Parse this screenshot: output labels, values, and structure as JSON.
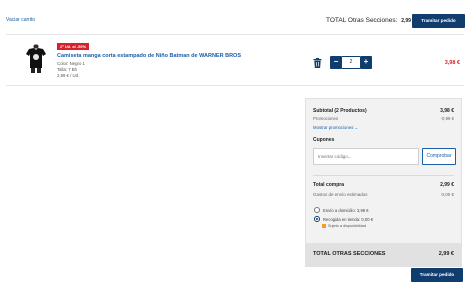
{
  "header": {
    "empty_cart": "Vaciar carrito",
    "total_label": "TOTAL Otras Secciones:",
    "total_value": "2,99 €",
    "checkout_label": "Tramitar pedido"
  },
  "cart": {
    "items": [
      {
        "badge": "2ª Ud. al -50%",
        "title": "Camiseta manga corta estampado de Niño Batman de WARNER BROS",
        "color": "Color: Negro 1",
        "size": "Talla: 7 Bh",
        "unit_price": "2,99 € / Ud.",
        "quantity": "2",
        "price": "3,98 €",
        "image_icon": "tshirt-icon"
      }
    ]
  },
  "summary": {
    "subtotal_label": "Subtotal (2 Productos)",
    "subtotal_value": "3,98 €",
    "promotions_label": "Promociones",
    "promotions_value": "-0,99 €",
    "show_promotions": "Mostrar promociones",
    "coupons_title": "Cupones",
    "coupon_placeholder": "Insertar código...",
    "apply_coupon": "Comprobar",
    "total_label": "Total compra",
    "total_value": "2,99 €",
    "shipping_label": "Gastos de envío estimados",
    "shipping_value": "0,00 €",
    "delivery_options": [
      {
        "label": "Envío a domicilio: 3,99 €",
        "selected": false
      },
      {
        "label": "Recogida en tienda: 0,00 €",
        "selected": true
      }
    ],
    "availability_note": "Sujeto a disponibilidad",
    "footer_label": "TOTAL OTRAS SECCIONES",
    "footer_value": "2,99 €"
  },
  "footer": {
    "checkout_label": "Tramitar pedido"
  },
  "colors": {
    "primary": "#103d6e",
    "link": "#1a5fa8",
    "sale": "#d8202a",
    "warning": "#f0a020"
  }
}
